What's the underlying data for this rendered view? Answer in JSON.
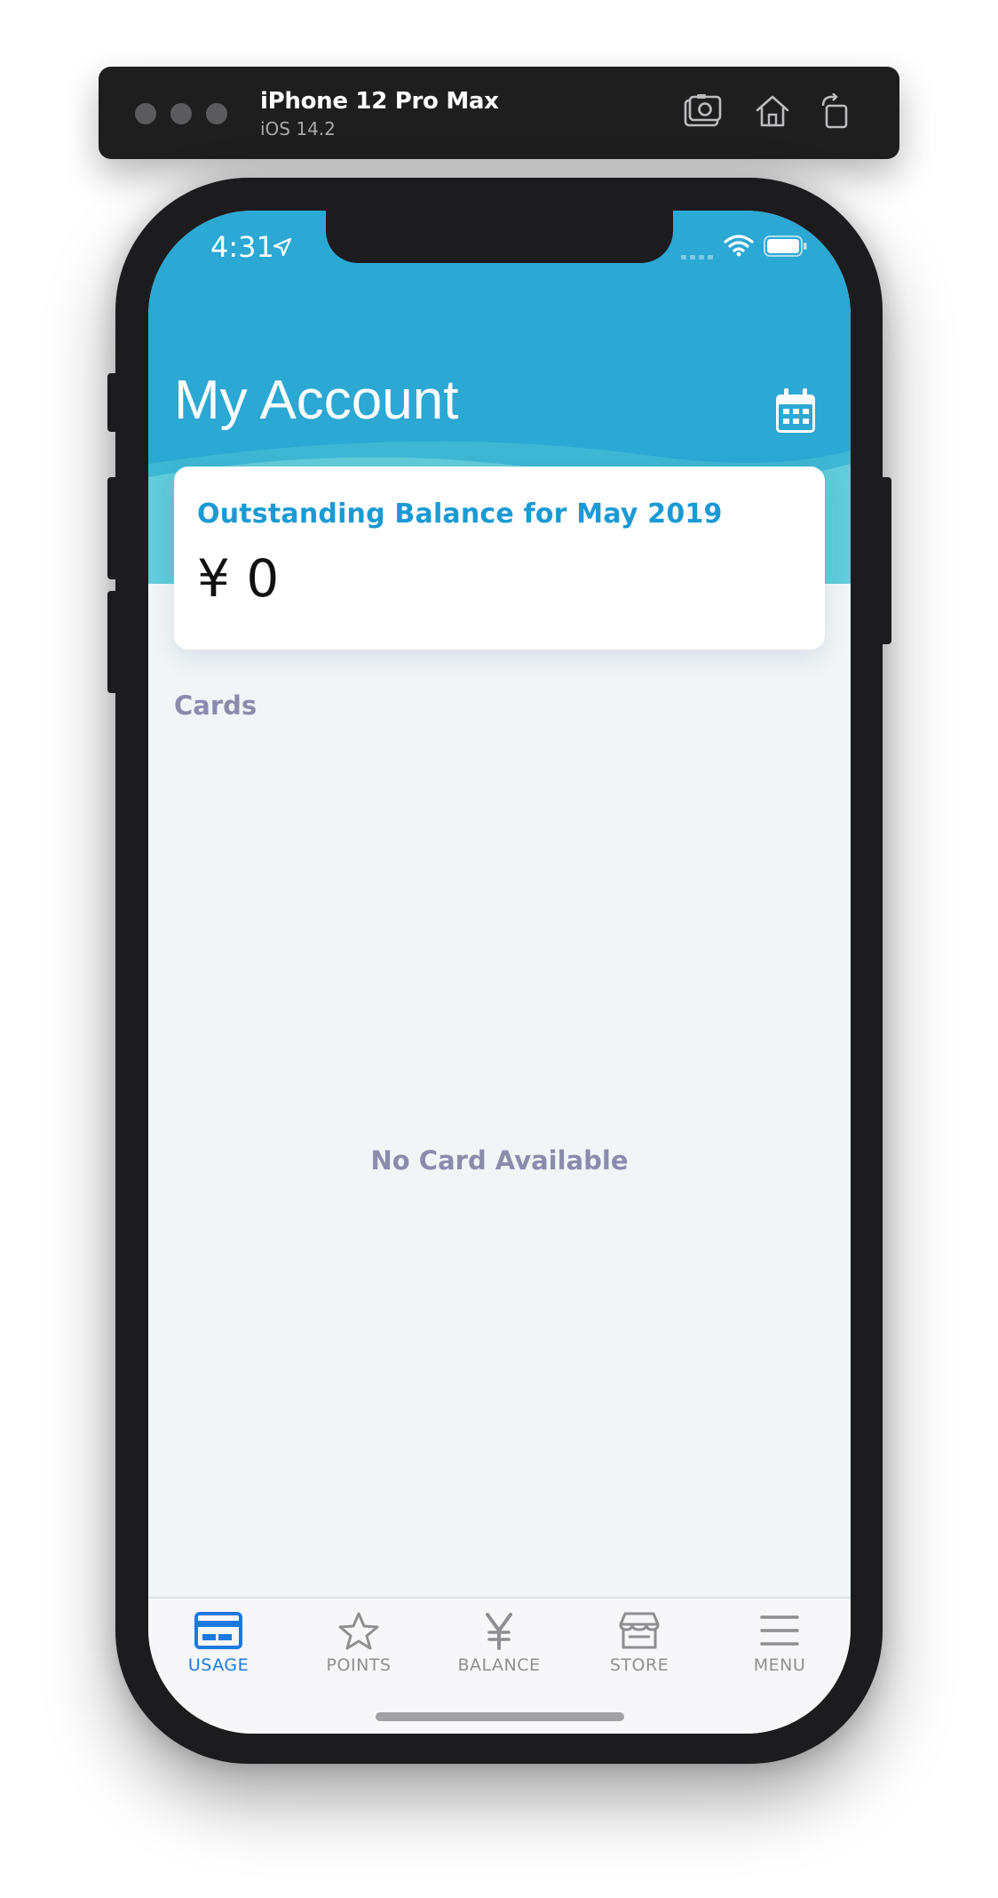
{
  "simulator": {
    "device_name": "iPhone 12 Pro Max",
    "os_version": "iOS 14.2",
    "toolbar_icons": [
      "screenshot-icon",
      "home-icon",
      "rotate-icon"
    ]
  },
  "status_bar": {
    "time": "4:31",
    "icons": [
      "location-arrow-icon",
      "cellular-signal-icon",
      "wifi-icon",
      "battery-icon"
    ]
  },
  "header": {
    "title": "My Account",
    "calendar_icon": "calendar-icon",
    "background_color": "#2ba8d3"
  },
  "balance": {
    "label": "Outstanding Balance for May 2019",
    "value": "¥ 0",
    "label_color": "#1a9ad4"
  },
  "cards_section": {
    "heading": "Cards",
    "empty_message": "No Card Available"
  },
  "tab_bar": {
    "active_color": "#1a7ae0",
    "inactive_color": "#8e8e93",
    "items": [
      {
        "label": "USAGE",
        "icon": "credit-card-icon",
        "active": true
      },
      {
        "label": "POINTS",
        "icon": "star-icon",
        "active": false
      },
      {
        "label": "BALANCE",
        "icon": "yen-icon",
        "active": false
      },
      {
        "label": "STORE",
        "icon": "store-icon",
        "active": false
      },
      {
        "label": "MENU",
        "icon": "hamburger-menu-icon",
        "active": false
      }
    ]
  }
}
